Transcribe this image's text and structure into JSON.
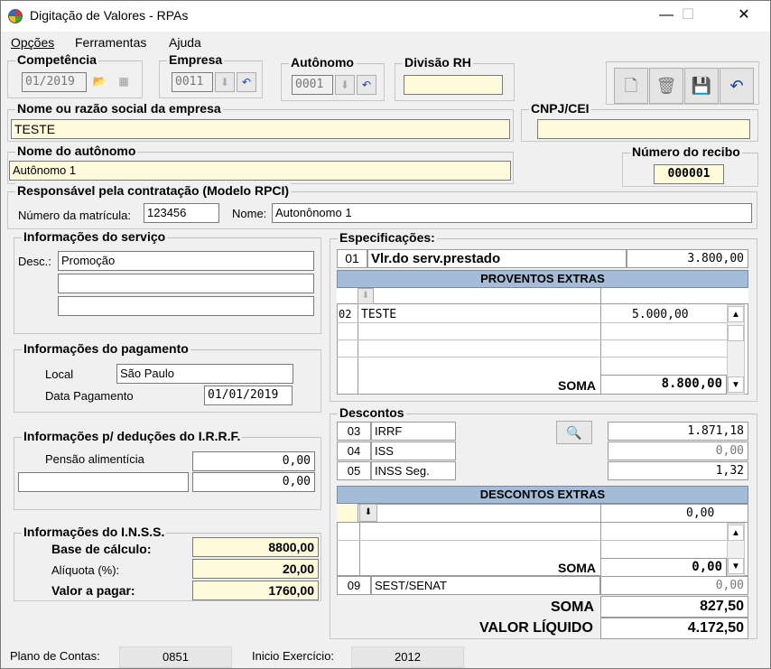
{
  "window": {
    "title": "Digitação de Valores - RPAs",
    "minimize": "—",
    "maximize": "☐",
    "close": "✕"
  },
  "menu": {
    "opcoes": "Opções",
    "ferramentas": "Ferramentas",
    "ajuda": "Ajuda"
  },
  "competencia": {
    "label": "Competência",
    "value": "01/2019"
  },
  "empresa": {
    "label": "Empresa",
    "value": "0011"
  },
  "autonomo": {
    "label": "Autônomo",
    "value": "0001"
  },
  "divisao": {
    "label": "Divisão RH",
    "value": ""
  },
  "nome_empresa": {
    "label": "Nome ou razão social da empresa",
    "value": "TESTE"
  },
  "cnpj": {
    "label": "CNPJ/CEI",
    "value": ""
  },
  "nome_autonomo": {
    "label": "Nome do autônomo",
    "value": "Autônomo 1"
  },
  "recibo": {
    "label": "Número do recibo",
    "value": "000001"
  },
  "responsavel": {
    "label": "Responsável pela contratação (Modelo RPCI)",
    "matricula_label": "Número da matrícula:",
    "matricula": "123456",
    "nome_label": "Nome:",
    "nome": "Autonônomo 1"
  },
  "servico": {
    "label": "Informações do serviço",
    "desc_label": "Desc.:",
    "desc1": "Promoção",
    "desc2": "",
    "desc3": ""
  },
  "pagamento": {
    "label": "Informações do pagamento",
    "local_label": "Local",
    "local": "São Paulo",
    "data_label": "Data Pagamento",
    "data": "01/01/2019"
  },
  "irrf": {
    "label": "Informações p/ deduções do I.R.R.F.",
    "pensao_label": "Pensão alimentícia",
    "pensao": "0,00",
    "outro_label": "",
    "outro": "0,00"
  },
  "inss": {
    "label": "Informações do I.N.S.S.",
    "base_label": "Base de cálculo:",
    "base": "8800,00",
    "aliquota_label": "Alíquota (%):",
    "aliquota": "20,00",
    "valor_label": "Valor a pagar:",
    "valor": "1760,00"
  },
  "especificacoes": {
    "label": "Especificações:",
    "row_num": "01",
    "row_label": "Vlr.do serv.prestado",
    "row_value": "3.800,00",
    "extras_header": "PROVENTOS EXTRAS",
    "extra_num": "02",
    "extra_label": "TESTE",
    "extra_value": "5.000,00",
    "soma_label": "SOMA",
    "soma": "8.800,00"
  },
  "descontos": {
    "label": "Descontos",
    "irrf_num": "03",
    "irrf_label": "IRRF",
    "irrf": "1.871,18",
    "iss_num": "04",
    "iss_label": "ISS",
    "iss": "0,00",
    "inss_num": "05",
    "inss_label": "INSS Seg.",
    "inss": "1,32",
    "extras_header": "DESCONTOS EXTRAS",
    "extra_value": "0,00",
    "soma_label": "SOMA",
    "soma": "0,00",
    "sest_num": "09",
    "sest_label": "SEST/SENAT",
    "sest": "0,00"
  },
  "totais": {
    "soma_label": "SOMA",
    "soma": "827,50",
    "liquido_label": "VALOR LÍQUIDO",
    "liquido": "4.172,50"
  },
  "statusbar": {
    "plano_label": "Plano de Contas:",
    "plano": "0851",
    "inicio_label": "Inicio Exercício:",
    "inicio": "2012"
  }
}
